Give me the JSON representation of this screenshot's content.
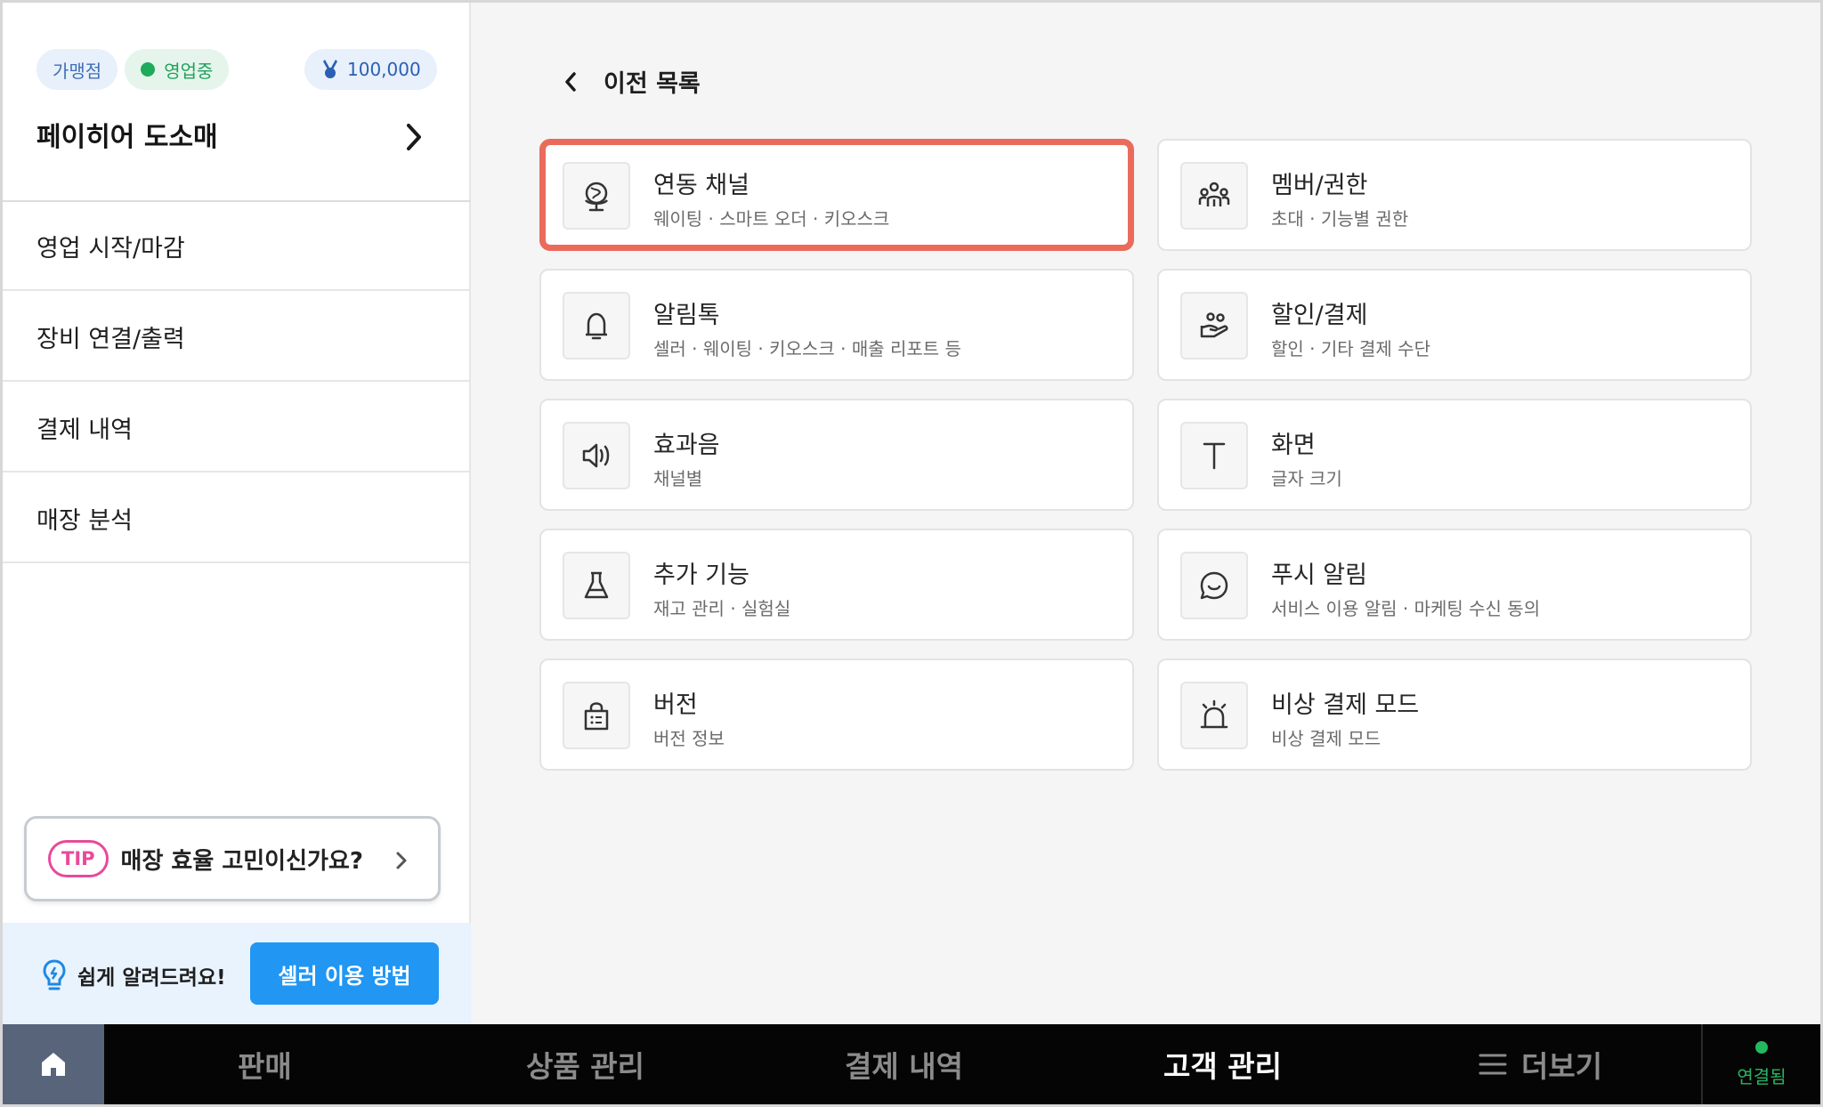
{
  "colors": {
    "accent": "#2196f3",
    "selected_border": "#ea6b5c",
    "open_status": "#1faa5c",
    "tip_pink": "#e84a9b",
    "connected_green": "#28b463"
  },
  "sidebar": {
    "badges": {
      "franchise": "가맹점",
      "open_status": "영업중",
      "points": "100,000"
    },
    "store_name": "페이히어 도소매",
    "menu": [
      {
        "label": "영업 시작/마감"
      },
      {
        "label": "장비 연결/출력"
      },
      {
        "label": "결제 내역"
      },
      {
        "label": "매장 분석"
      }
    ],
    "tip": {
      "badge": "TIP",
      "text": "매장 효율 고민이신가요?"
    },
    "help": {
      "text": "쉽게 알려드려요!",
      "button": "셀러 이용 방법"
    }
  },
  "main": {
    "back_label": "이전 목록",
    "cards": [
      {
        "title": "연동 채널",
        "subtitle": "웨이팅 · 스마트 오더 · 키오스크",
        "icon": "globe-icon",
        "selected": true
      },
      {
        "title": "멤버/권한",
        "subtitle": "초대 · 기능별 권한",
        "icon": "members-icon"
      },
      {
        "title": "알림톡",
        "subtitle": "셀러 · 웨이팅 · 키오스크 · 매출 리포트 등",
        "icon": "bell-icon"
      },
      {
        "title": "할인/결제",
        "subtitle": "할인 · 기타 결제 수단",
        "icon": "hand-coins-icon"
      },
      {
        "title": "효과음",
        "subtitle": "채널별",
        "icon": "speaker-icon"
      },
      {
        "title": "화면",
        "subtitle": "글자 크기",
        "icon": "text-size-icon"
      },
      {
        "title": "추가 기능",
        "subtitle": "재고 관리 · 실험실",
        "icon": "flask-icon"
      },
      {
        "title": "푸시 알림",
        "subtitle": "서비스 이용 알림 · 마케팅 수신 동의",
        "icon": "chat-smile-icon"
      },
      {
        "title": "버전",
        "subtitle": "버전 정보",
        "icon": "bag-icon"
      },
      {
        "title": "비상 결제 모드",
        "subtitle": "비상 결제 모드",
        "icon": "siren-icon"
      }
    ]
  },
  "bottom_nav": {
    "items": [
      {
        "label": "판매"
      },
      {
        "label": "상품 관리"
      },
      {
        "label": "결제 내역"
      },
      {
        "label": "고객 관리",
        "active": true
      },
      {
        "label": "더보기"
      }
    ],
    "status": "연결됨"
  }
}
